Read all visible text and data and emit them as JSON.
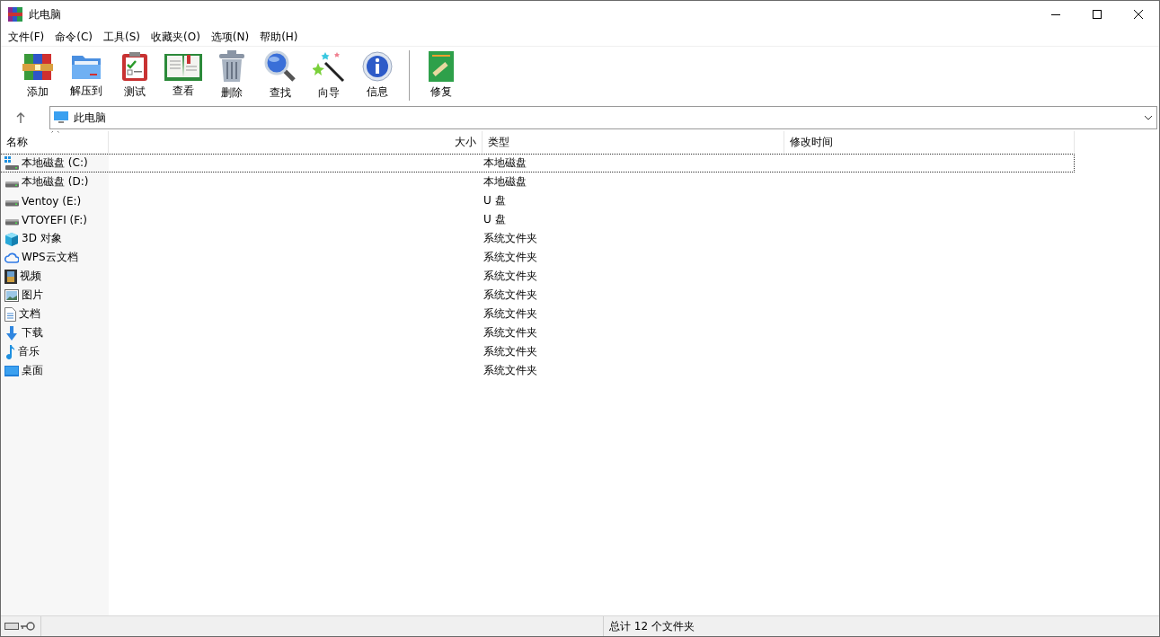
{
  "window": {
    "title": "此电脑"
  },
  "menu": [
    "文件(F)",
    "命令(C)",
    "工具(S)",
    "收藏夹(O)",
    "选项(N)",
    "帮助(H)"
  ],
  "toolbar": [
    {
      "label": "添加"
    },
    {
      "label": "解压到"
    },
    {
      "label": "测试"
    },
    {
      "label": "查看"
    },
    {
      "label": "删除"
    },
    {
      "label": "查找"
    },
    {
      "label": "向导"
    },
    {
      "label": "信息"
    },
    {
      "label": "修复"
    }
  ],
  "address": {
    "value": "此电脑"
  },
  "table": {
    "columns": [
      "名称",
      "大小",
      "类型",
      "修改时间"
    ],
    "rows": [
      {
        "name": "本地磁盘 (C:)",
        "type": "本地磁盘",
        "kind": "system-drive",
        "selected": true
      },
      {
        "name": "本地磁盘 (D:)",
        "type": "本地磁盘",
        "kind": "drive",
        "selected": false
      },
      {
        "name": "Ventoy (E:)",
        "type": "U 盘",
        "kind": "drive",
        "selected": false
      },
      {
        "name": "VTOYEFI (F:)",
        "type": "U 盘",
        "kind": "drive",
        "selected": false
      },
      {
        "name": "3D 对象",
        "type": "系统文件夹",
        "kind": "cube",
        "selected": false
      },
      {
        "name": "WPS云文档",
        "type": "系统文件夹",
        "kind": "cloud",
        "selected": false
      },
      {
        "name": "视频",
        "type": "系统文件夹",
        "kind": "video",
        "selected": false
      },
      {
        "name": "图片",
        "type": "系统文件夹",
        "kind": "picture",
        "selected": false
      },
      {
        "name": "文档",
        "type": "系统文件夹",
        "kind": "document",
        "selected": false
      },
      {
        "name": "下载",
        "type": "系统文件夹",
        "kind": "download",
        "selected": false
      },
      {
        "name": "音乐",
        "type": "系统文件夹",
        "kind": "music",
        "selected": false
      },
      {
        "name": "桌面",
        "type": "系统文件夹",
        "kind": "desktop",
        "selected": false
      }
    ]
  },
  "status_bar": {
    "text": "总计 12 个文件夹"
  }
}
